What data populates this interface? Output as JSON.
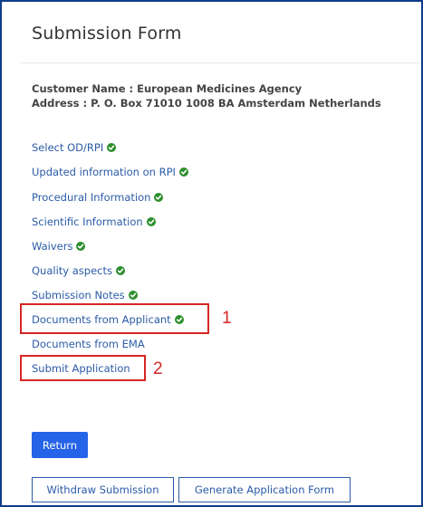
{
  "page": {
    "title": "Submission Form"
  },
  "customer": {
    "name_line": "Customer Name : European Medicines Agency",
    "address_line": "Address : P. O. Box 71010 1008 BA Amsterdam Netherlands"
  },
  "nav": [
    {
      "label": "Select OD/RPI",
      "completed": true
    },
    {
      "label": "Updated information on RPI",
      "completed": true
    },
    {
      "label": "Procedural Information",
      "completed": true
    },
    {
      "label": "Scientific Information",
      "completed": true
    },
    {
      "label": "Waivers",
      "completed": true
    },
    {
      "label": "Quality aspects",
      "completed": true
    },
    {
      "label": "Submission Notes",
      "completed": true
    },
    {
      "label": "Documents from Applicant",
      "completed": true
    },
    {
      "label": "Documents from EMA",
      "completed": false
    },
    {
      "label": "Submit Application",
      "completed": false
    }
  ],
  "annotations": {
    "marker_1": "1",
    "marker_2": "2",
    "color": "#d62626"
  },
  "buttons": {
    "return_label": "Return",
    "withdraw_label": "Withdraw Submission",
    "generate_label": "Generate Application Form"
  },
  "colors": {
    "link": "#2b5ba8",
    "check": "#2e8f2e",
    "primary": "#2563e8",
    "frame_border": "#0f3c8c"
  }
}
